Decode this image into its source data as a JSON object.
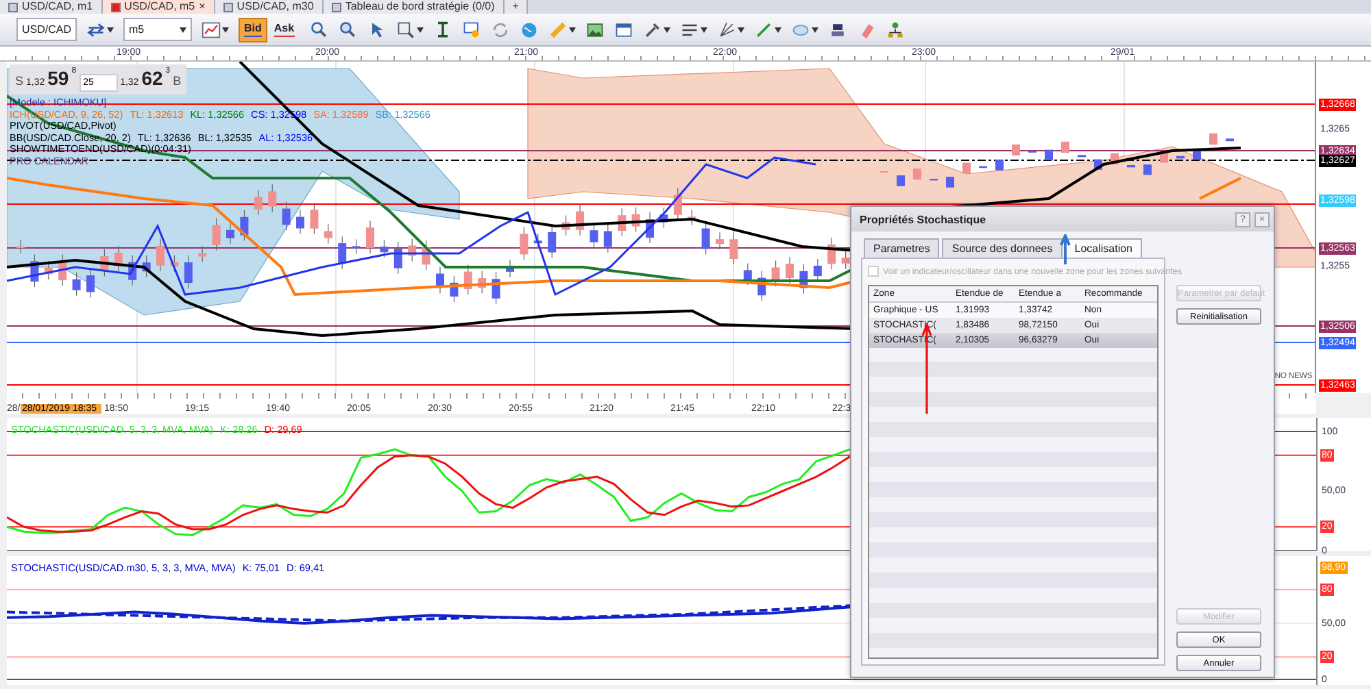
{
  "tabs": [
    {
      "label": "USD/CAD, m1",
      "selected": false
    },
    {
      "label": "USD/CAD, m5",
      "selected": true,
      "close": "×"
    },
    {
      "label": "USD/CAD, m30",
      "selected": false
    },
    {
      "label": "Tableau de bord stratégie (0/0)",
      "selected": false
    },
    {
      "label": "+",
      "selected": false
    }
  ],
  "toolbar": {
    "symbol": "USD/CAD",
    "timeframe": "m5",
    "bid": {
      "label": "Bid",
      "selected": true
    },
    "ask": {
      "label": "Ask",
      "selected": false
    }
  },
  "time_axis_top": [
    "19:00",
    "20:00",
    "21:00",
    "22:00",
    "23:00",
    "29/01"
  ],
  "quote": {
    "sell_label": "S",
    "sell_prefix": "1,32",
    "sell_big": "59",
    "sell_pip": "8",
    "amount": "25",
    "buy_prefix": "1,32",
    "buy_big": "62",
    "buy_pip": "3",
    "buy_label": "B"
  },
  "legend": [
    [
      {
        "text": "[Modele : ICHIMOKU]",
        "color": "#333399"
      }
    ],
    [
      {
        "text": "ICH(USD/CAD, 9, 26, 52)",
        "color": "#ff6600"
      },
      {
        "text": "TL: 1,32613",
        "color": "#ff6600"
      },
      {
        "text": "KL: 1,32566",
        "color": "#008000"
      },
      {
        "text": "CS: 1,32598",
        "color": "#0000ff"
      },
      {
        "text": "SA: 1,32589",
        "color": "#ff6633"
      },
      {
        "text": "SB: 1,32566",
        "color": "#3399cc"
      }
    ],
    [
      {
        "text": "PIVOT(USD/CAD,Pivot)",
        "color": "#000000"
      }
    ],
    [
      {
        "text": "BB(USD/CAD.Close, 20, 2)",
        "color": "#000000"
      },
      {
        "text": "TL: 1,32636",
        "color": "#000000"
      },
      {
        "text": "BL: 1,32535",
        "color": "#000000"
      },
      {
        "text": "AL: 1,32536",
        "color": "#0000ff"
      }
    ],
    [
      {
        "text": "SHOWTIMETOEND(USD/CAD)(0:04:31)",
        "color": "#000000"
      }
    ],
    [
      {
        "text": "PRO CALENDAR",
        "color": "#663366"
      }
    ]
  ],
  "no_news": "NO NEWS",
  "price_axis": [
    {
      "text": "1,32668",
      "kind": "tag",
      "color": "#ff0000"
    },
    {
      "text": "1,3265",
      "kind": "tick"
    },
    {
      "text": "1,32634",
      "kind": "tag",
      "color": "#993366"
    },
    {
      "text": "1,32627",
      "kind": "tag",
      "color": "#000000"
    },
    {
      "text": "1,32598",
      "kind": "tag",
      "color": "#33ccff"
    },
    {
      "text": "1,32563",
      "kind": "tag",
      "color": "#993366"
    },
    {
      "text": "1,3255",
      "kind": "tick"
    },
    {
      "text": "1,32506",
      "kind": "tag",
      "color": "#993366"
    },
    {
      "text": "1,32494",
      "kind": "tag",
      "color": "#3366ff"
    },
    {
      "text": "1,32463",
      "kind": "tag",
      "color": "#ff0000"
    }
  ],
  "time_axis_bottom": {
    "start": "28/",
    "cursor": "28/01/2019 18:35",
    "labels": [
      "18:50",
      "19:15",
      "19:40",
      "20:05",
      "20:30",
      "20:55",
      "21:20",
      "21:45",
      "22:10",
      "22:3"
    ]
  },
  "oscillators": [
    {
      "legend": [
        {
          "text": "STOCHASTIC(USD/CAD, 5, 3, 3, MVA, MVA)",
          "color": "#33dd33"
        },
        {
          "text": "K: 28,26",
          "color": "#33dd33"
        },
        {
          "text": "D: 29,69",
          "color": "#ff0000"
        }
      ],
      "axis": [
        {
          "text": "100",
          "kind": "tick"
        },
        {
          "text": "80",
          "kind": "tag",
          "color": "#ff3333"
        },
        {
          "text": "50,00",
          "kind": "tick"
        },
        {
          "text": "20",
          "kind": "tag",
          "color": "#ff3333"
        },
        {
          "text": "0",
          "kind": "tick"
        }
      ]
    },
    {
      "legend": [
        {
          "text": "STOCHASTIC(USD/CAD.m30, 5, 3, 3, MVA, MVA)",
          "color": "#0000cc"
        },
        {
          "text": "K: 75,01",
          "color": "#0000cc"
        },
        {
          "text": "D: 69,41",
          "color": "#0000cc"
        }
      ],
      "axis": [
        {
          "text": "98,90",
          "kind": "tag",
          "color": "#ff9900"
        },
        {
          "text": "80",
          "kind": "tag",
          "color": "#ff3333"
        },
        {
          "text": "50,00",
          "kind": "tick"
        },
        {
          "text": "20",
          "kind": "tag",
          "color": "#ff3333"
        },
        {
          "text": "0",
          "kind": "tick"
        }
      ]
    }
  ],
  "dialog": {
    "title": "Propriétés Stochastique",
    "help": "?",
    "close": "×",
    "tabs": [
      {
        "label": "Parametres",
        "selected": false
      },
      {
        "label": "Source des donnees",
        "selected": false
      },
      {
        "label": "Localisation",
        "selected": true
      }
    ],
    "checkbox": {
      "label": "Voir un indicateur/oscillateur dans une nouvelle zone pour les zones suivantes",
      "checked": false,
      "disabled": true
    },
    "table": {
      "columns": [
        "Zone",
        "Etendue de",
        "Etendue a",
        "Recommande"
      ],
      "rows": [
        {
          "cells": [
            "Graphique - US",
            "1,31993",
            "1,33742",
            "Non"
          ],
          "selected": false
        },
        {
          "cells": [
            "STOCHASTIC(",
            "1,83486",
            "98,72150",
            "Oui"
          ],
          "selected": false
        },
        {
          "cells": [
            "STOCHASTIC(",
            "2,10305",
            "96,63279",
            "Oui"
          ],
          "selected": true
        }
      ]
    },
    "buttons_top": [
      {
        "label": "Parametrer par defaut",
        "disabled": true
      },
      {
        "label": "Reinitialisation",
        "disabled": false
      }
    ],
    "buttons_bottom": [
      {
        "label": "Modifier",
        "disabled": true
      },
      {
        "label": "OK",
        "disabled": false
      },
      {
        "label": "Annuler",
        "disabled": false
      }
    ]
  }
}
